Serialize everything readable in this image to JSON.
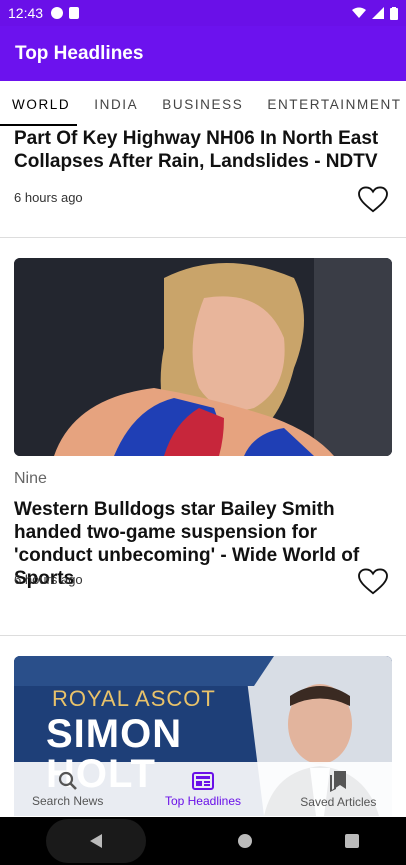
{
  "status_bar": {
    "time": "12:43"
  },
  "app_bar": {
    "title": "Top Headlines"
  },
  "tabs": [
    "WORLD",
    "INDIA",
    "BUSINESS",
    "ENTERTAINMENT"
  ],
  "articles": [
    {
      "headline": "Part Of Key Highway NH06 In North East Collapses After Rain, Landslides - NDTV",
      "time_ago": "6 hours ago"
    },
    {
      "source": "Nine",
      "headline": "Western Bulldogs star Bailey Smith handed two-game suspension for 'conduct unbecoming' - Wide World of Sports",
      "time_ago": "6 hours ago"
    },
    {
      "image_text": {
        "line1": "ROYAL ASCOT",
        "line2": "SIMON",
        "line3": "HOLT"
      }
    }
  ],
  "bottom_nav": [
    {
      "label": "Search News",
      "icon": "search-icon"
    },
    {
      "label": "Top Headlines",
      "icon": "newspaper-icon"
    },
    {
      "label": "Saved Articles",
      "icon": "bookmarks-icon"
    }
  ],
  "colors": {
    "primary": "#6c12ee",
    "status_bar": "#6a10e8",
    "active_nav": "#6a10e8"
  }
}
